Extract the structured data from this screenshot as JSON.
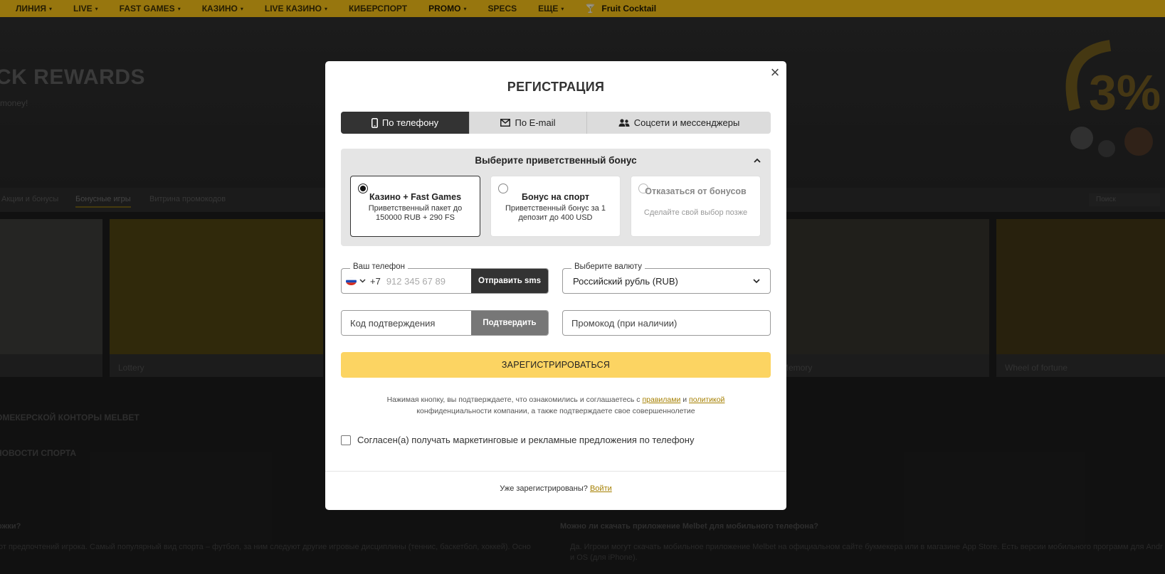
{
  "background": {
    "nav": [
      {
        "label": "ЛИНИЯ",
        "chevron": true
      },
      {
        "label": "LIVE",
        "chevron": true
      },
      {
        "label": "FAST GAMES",
        "chevron": true
      },
      {
        "label": "КАЗИНО",
        "chevron": true
      },
      {
        "label": "LIVE КАЗИНО",
        "chevron": true
      },
      {
        "label": "КИБЕРСПОРТ",
        "chevron": false
      },
      {
        "label": "PROMO",
        "chevron": true
      },
      {
        "label": "SPECS",
        "chevron": false
      },
      {
        "label": "ЕЩЕ",
        "chevron": true
      },
      {
        "label": "Fruit Cocktail",
        "chevron": false
      }
    ],
    "hero_title": "CK REWARDS",
    "hero_sub": "money!",
    "hero_badge": "3%",
    "tabs": [
      "Акции и бонусы",
      "Бонусные игры",
      "Витрина промокодов"
    ],
    "search_placeholder": "Поиск",
    "games": [
      "",
      "Lottery",
      "",
      "Memory",
      "Wheel of fortune"
    ],
    "seo_lines": [
      "ОМЕКЕРСКОЙ КОНТОРЫ MELBET",
      "НОВОСТИ СПОРТА"
    ],
    "faq_q1": "ожки?",
    "faq_q2": "Можно ли скачать приложение Melbet для мобильного телефона?",
    "faq_a1": "от предпочтений игрока. Самый популярный вид спорта – футбол, за ним следуют другие игровые дисциплины (теннис, баскетбол, хоккей). Осно",
    "faq_a2": "Да. Игроки могут скачать мобильное приложение Melbet на официальном сайте букмекера или в магазине App Store. Есть версии мобильного программ для Andr и OS (для iPhone)."
  },
  "modal": {
    "close_icon": "×",
    "title": "РЕГИСТРАЦИЯ",
    "tabs": [
      {
        "label": "По телефону",
        "icon": "phone-icon",
        "active": true
      },
      {
        "label": "По E-mail",
        "icon": "envelope-icon",
        "active": false
      },
      {
        "label": "Соцсети и мессенджеры",
        "icon": "users-icon",
        "active": false
      }
    ],
    "bonus": {
      "heading": "Выберите приветственный бонус",
      "options": [
        {
          "title": "Казино + Fast Games",
          "desc": "Приветственный пакет до 150000 RUB + 290 FS",
          "selected": true
        },
        {
          "title": "Бонус на спорт",
          "desc": "Приветственный бонус за 1 депозит до 400 USD",
          "selected": false
        },
        {
          "title": "Отказаться от бонусов",
          "desc": "Сделайте свой выбор позже",
          "selected": false
        }
      ]
    },
    "phone": {
      "label": "Ваш телефон",
      "prefix": "+7",
      "placeholder": "912 345 67 89",
      "sms_button": "Отправить sms"
    },
    "currency": {
      "label": "Выберите валюту",
      "value": "Российский рубль (RUB)"
    },
    "code": {
      "placeholder": "Код подтверждения",
      "confirm_button": "Подтвердить"
    },
    "promo_placeholder": "Промокод (при наличии)",
    "register_button": "ЗАРЕГИСТРИРОВАТЬСЯ",
    "terms": {
      "part1": "Нажимая кнопку, вы подтверждаете, что ознакомились и соглашаетесь с",
      "rules_link": "правилами",
      "and": "и",
      "policy_link": "политикой",
      "part2": "конфиденциальности компании, а также подтверждаете свое совершеннолетие"
    },
    "consent_label": "Согласен(а) получать маркетинговые и рекламные предложения по телефону",
    "footer": {
      "question": "Уже зарегистрированы?",
      "login_link": "Войти"
    }
  },
  "colors": {
    "accent_yellow": "#fcd462",
    "nav_yellow": "#e8b516",
    "link_gold": "#a57f00",
    "dark_button": "#333333"
  }
}
